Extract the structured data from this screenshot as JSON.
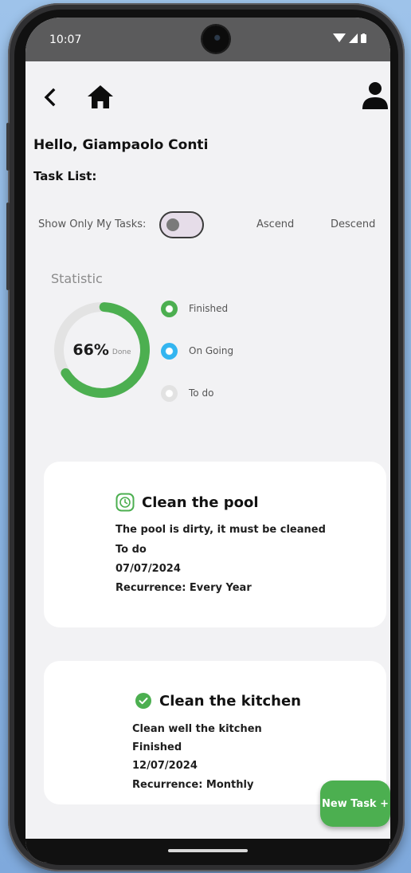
{
  "status_bar": {
    "time": "10:07",
    "icons": [
      "wifi-icon",
      "signal-icon",
      "battery-icon"
    ]
  },
  "topbar": {
    "icons": [
      "back-arrow-icon",
      "home-icon",
      "profile-icon"
    ]
  },
  "greeting": "Hello, Giampaolo Conti",
  "task_list_label": "Task List:",
  "filters": {
    "show_only_mine_label": "Show Only My Tasks:",
    "show_only_mine_on": false,
    "ascend_label": "Ascend",
    "descend_label": "Descend"
  },
  "statistics": {
    "title": "Statistic",
    "percent_text": "66%",
    "done_label": "Done",
    "percent_value": 66,
    "legend": [
      {
        "label": "Finished",
        "color": "#4caf50"
      },
      {
        "label": "On Going",
        "color": "#33b5f0"
      },
      {
        "label": "To do",
        "color": "#e2e2e2"
      }
    ],
    "colors": {
      "arc": "#4caf50",
      "track": "#e3e3e3"
    }
  },
  "tasks": [
    {
      "title": "Clean the pool",
      "icon": "clock-icon",
      "description": "The pool is dirty, it must be cleaned",
      "status": "To do",
      "date": "07/07/2024",
      "recurrence": "Recurrence: Every Year"
    },
    {
      "title": "Clean the kitchen",
      "icon": "check-circle-icon",
      "description": "Clean well the kitchen",
      "status": "Finished",
      "date": "12/07/2024",
      "recurrence": "Recurrence: Monthly"
    }
  ],
  "fab_label": "New Task +",
  "colors": {
    "accent": "#4caf50",
    "background": "#f2f2f4",
    "card": "#ffffff"
  }
}
